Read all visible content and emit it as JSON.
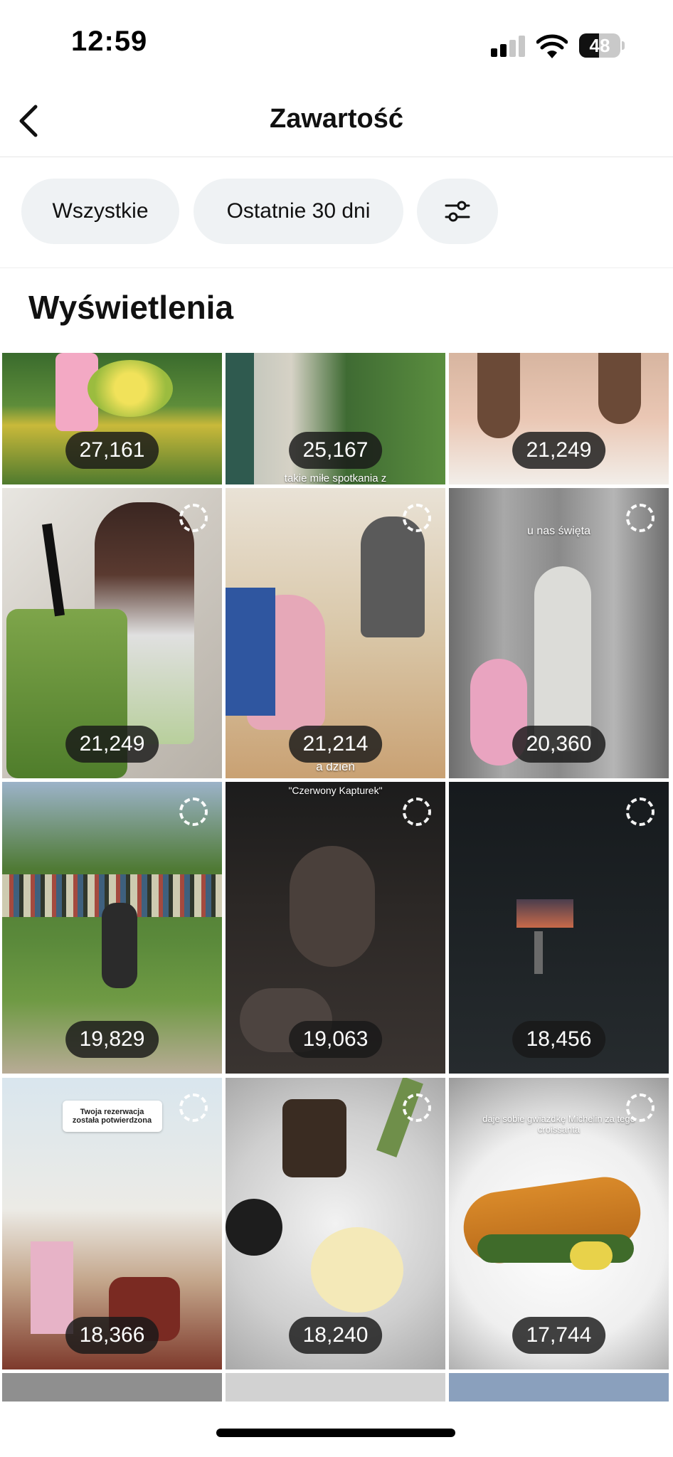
{
  "status_bar": {
    "time": "12:59",
    "battery": "48",
    "battery_level": 0.48
  },
  "header": {
    "title": "Zawartość"
  },
  "filters": {
    "all_label": "Wszystkie",
    "period_label": "Ostatnie 30 dni"
  },
  "section": {
    "title": "Wyświetlenia"
  },
  "colors": {
    "chip_bg": "#eff2f4",
    "badge_bg": "#181818"
  },
  "tiles": [
    {
      "views": "27,161",
      "scene": "flowers-garden",
      "caption": ""
    },
    {
      "views": "25,167",
      "scene": "building-tree",
      "caption": "takie miłe spotkania z"
    },
    {
      "views": "21,249",
      "scene": "child-smile",
      "caption": ""
    },
    {
      "views": "21,249",
      "scene": "woman-drink",
      "caption": ""
    },
    {
      "views": "21,214",
      "scene": "hair-salon",
      "caption": "a dzień"
    },
    {
      "views": "20,360",
      "scene": "elevator-selfie",
      "caption": "u nas święta"
    },
    {
      "views": "19,829",
      "scene": "park-event",
      "caption": ""
    },
    {
      "views": "19,063",
      "scene": "dark-portrait",
      "caption": "\"Czerwony Kapturek\""
    },
    {
      "views": "18,456",
      "scene": "dark-hallway",
      "caption": ""
    },
    {
      "views": "18,366",
      "scene": "hotel-room",
      "caption": "Twoja rezerwacja została potwierdzona"
    },
    {
      "views": "18,240",
      "scene": "food-jar",
      "caption": ""
    },
    {
      "views": "17,744",
      "scene": "croissant",
      "caption": "daje sobie gwiazdkę Michelin za tego croissanta"
    }
  ]
}
